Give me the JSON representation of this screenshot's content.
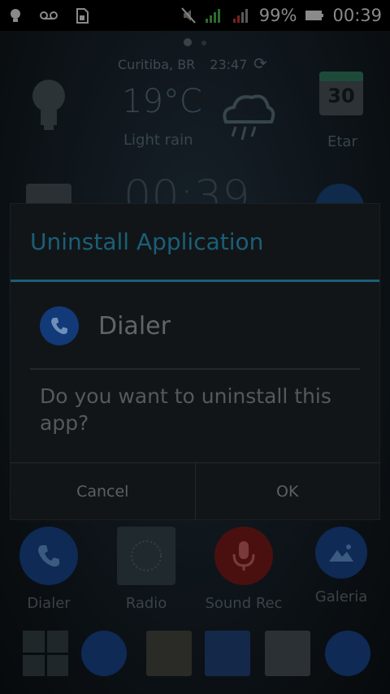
{
  "statusbar": {
    "battery_percent": "99%",
    "time": "00:39"
  },
  "weather": {
    "location": "Curitiba, BR",
    "time": "23:47",
    "temperature": "19°C",
    "condition": "Light rain"
  },
  "calendar": {
    "day": "30",
    "label": "Etar"
  },
  "clock_partial": "00:39",
  "dialog": {
    "title": "Uninstall Application",
    "app_name": "Dialer",
    "message": "Do you want to uninstall this app?",
    "cancel_label": "Cancel",
    "ok_label": "OK"
  },
  "apps": [
    {
      "label": "Dialer"
    },
    {
      "label": "Radio"
    },
    {
      "label": "Sound Rec"
    },
    {
      "label": "Galeria"
    }
  ],
  "colors": {
    "accent": "#1a5f78",
    "dialog_bg": "#121517",
    "dialer_blue": "#123a78"
  }
}
